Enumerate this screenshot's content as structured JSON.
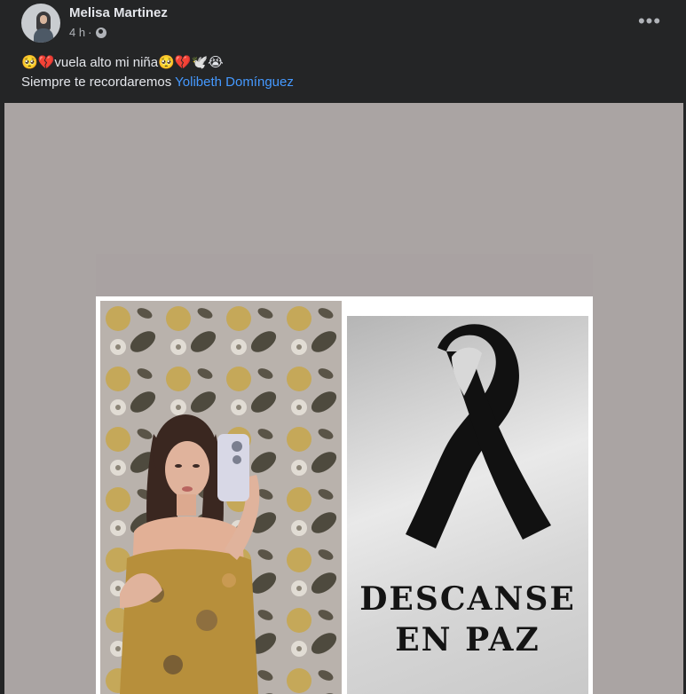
{
  "post": {
    "author": "Melisa Martinez",
    "time": "4 h",
    "separator": "·",
    "privacy_icon": "globe-icon",
    "more_icon": "more-options-icon",
    "more_label": "•••",
    "caption": {
      "line1_emoji_start": "🥺💔",
      "line1_text": "vuela alto mi niña",
      "line1_emoji_end": "🥺💔🕊️😭",
      "line2_text": "Siempre te recordaremos ",
      "mention": "Yolibeth Domínguez"
    },
    "image": {
      "ribbon_icon": "mourning-ribbon-icon",
      "text_line1": "DESCANSE",
      "text_line2": "EN PAZ"
    }
  },
  "colors": {
    "background": "#242526",
    "text": "#e4e6eb",
    "secondary_text": "#b0b3b8",
    "link": "#4599ff",
    "media_bg": "#aaa4a3"
  }
}
